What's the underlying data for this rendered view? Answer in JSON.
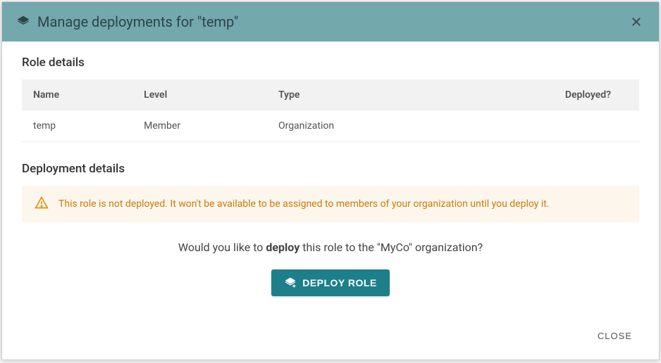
{
  "header": {
    "title": "Manage deployments for \"temp\""
  },
  "sections": {
    "role_details_title": "Role details",
    "deployment_details_title": "Deployment details"
  },
  "table": {
    "headers": {
      "name": "Name",
      "level": "Level",
      "type": "Type",
      "deployed": "Deployed?"
    },
    "row": {
      "name": "temp",
      "level": "Member",
      "type": "Organization",
      "deployed": ""
    }
  },
  "alert": {
    "text": "This role is not deployed. It won't be available to be assigned to members of your organization until you deploy it."
  },
  "prompt": {
    "pre": "Would you like to ",
    "bold": "deploy",
    "post": " this role to the \"MyCo\" organization?"
  },
  "buttons": {
    "deploy": "DEPLOY ROLE",
    "close": "CLOSE"
  }
}
